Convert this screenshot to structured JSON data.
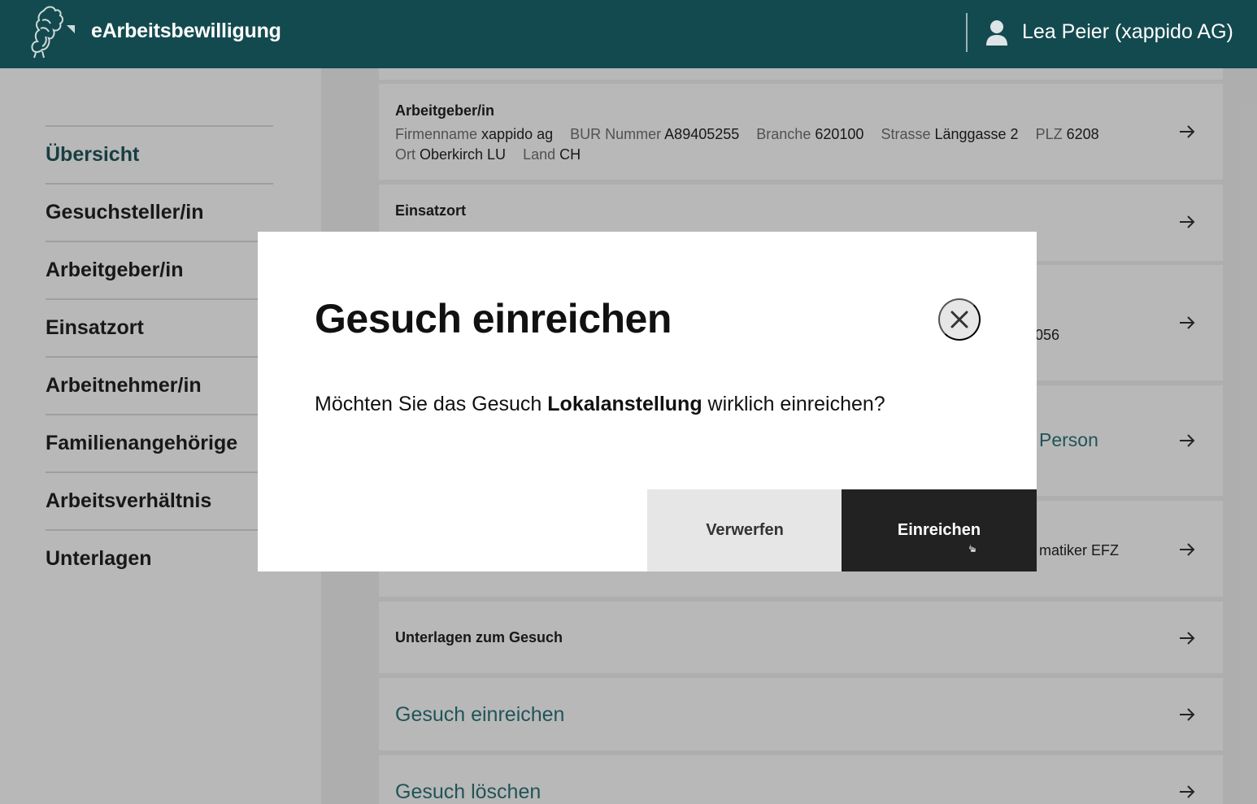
{
  "header": {
    "app_title": "eArbeitsbewilligung",
    "user_label": "Lea Peier (xappido AG)"
  },
  "sidebar": {
    "items": [
      {
        "label": "Übersicht",
        "active": true
      },
      {
        "label": "Gesuchsteller/in",
        "active": false
      },
      {
        "label": "Arbeitgeber/in",
        "active": false
      },
      {
        "label": "Einsatzort",
        "active": false
      },
      {
        "label": "Arbeitnehmer/in",
        "active": false
      },
      {
        "label": "Familienangehörige",
        "active": false
      },
      {
        "label": "Arbeitsverhältnis",
        "active": false
      },
      {
        "label": "Unterlagen",
        "active": false
      }
    ]
  },
  "content": {
    "employer_card": {
      "title": "Arbeitgeber/in",
      "fields": {
        "firmenname_label": "Firmenname",
        "firmenname_value": "xappido ag",
        "bur_label": "BUR Nummer",
        "bur_value": "A89405255",
        "branche_label": "Branche",
        "branche_value": "620100",
        "strasse_label": "Strasse",
        "strasse_value": "Länggasse 2",
        "plz_label": "PLZ",
        "plz_value": "6208",
        "ort_label": "Ort",
        "ort_value": "Oberkirch LU",
        "land_label": "Land",
        "land_value": "CH"
      }
    },
    "einsatzort_card": {
      "title": "Einsatzort"
    },
    "partial_texts": {
      "card3_fragment": "056",
      "card4_fragment": "Person",
      "card5_fragment": "matiker EFZ"
    },
    "unterlagen_card": {
      "title": "Unterlagen zum Gesuch"
    },
    "submit_link": "Gesuch einreichen",
    "delete_link": "Gesuch löschen"
  },
  "modal": {
    "title": "Gesuch einreichen",
    "message_before": "Möchten Sie das Gesuch ",
    "message_bold": "Lokalanstellung",
    "message_after": " wirklich einreichen?",
    "discard_label": "Verwerfen",
    "submit_label": "Einreichen"
  },
  "colors": {
    "brand": "#134a4f",
    "link": "#1f6a6f",
    "primary_button": "#222222",
    "secondary_button": "#e6e6e6"
  },
  "icons": [
    "logo-icon",
    "user-icon",
    "arrow-right-icon",
    "close-icon",
    "cursor-icon"
  ]
}
